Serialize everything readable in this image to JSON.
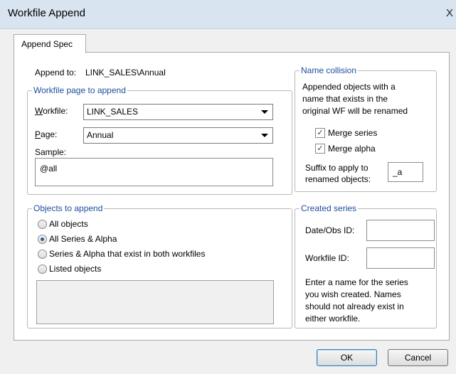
{
  "window": {
    "title": "Workfile Append",
    "close_glyph": "X"
  },
  "tabs": [
    {
      "label": "Append Spec",
      "active": true
    }
  ],
  "append_to": {
    "label": "Append to:",
    "value": "LINK_SALES\\Annual"
  },
  "workfile_page": {
    "legend": "Workfile page to append",
    "workfile_label_u": "W",
    "workfile_label_rest": "orkfile:",
    "workfile_value": "LINK_SALES",
    "page_label_u": "P",
    "page_label_rest": "age:",
    "page_value": "Annual",
    "sample_label": "Sample:",
    "sample_value": "@all"
  },
  "objects": {
    "legend": "Objects to append",
    "options": [
      {
        "label": "All objects",
        "checked": false
      },
      {
        "label": "All Series & Alpha",
        "checked": true
      },
      {
        "label": "Series & Alpha that exist in both workfiles",
        "checked": false
      },
      {
        "label": "Listed objects",
        "checked": false
      }
    ]
  },
  "name_collision": {
    "legend": "Name collision",
    "desc_lines": [
      "Appended objects with a",
      "name that exists in the",
      "original WF will be renamed"
    ],
    "merge_series_label": "Merge series",
    "merge_series_checked": true,
    "merge_alpha_label": "Merge alpha",
    "merge_alpha_checked": true,
    "suffix_label_1": "Suffix to apply to",
    "suffix_label_2": "renamed objects:",
    "suffix_value": "_a"
  },
  "created_series": {
    "legend": "Created series",
    "date_label": "Date/Obs ID:",
    "date_value": "",
    "workfile_id_label": "Workfile ID:",
    "workfile_id_value": "",
    "desc_lines": [
      "Enter a name for the series",
      "you wish created. Names",
      "should not already exist in",
      "either workfile."
    ]
  },
  "buttons": {
    "ok": "OK",
    "cancel": "Cancel"
  },
  "colors": {
    "titlebar": "#d9e4f1",
    "legend": "#1c4f9e",
    "panel": "#ffffff",
    "dialog": "#f0f0f0"
  }
}
